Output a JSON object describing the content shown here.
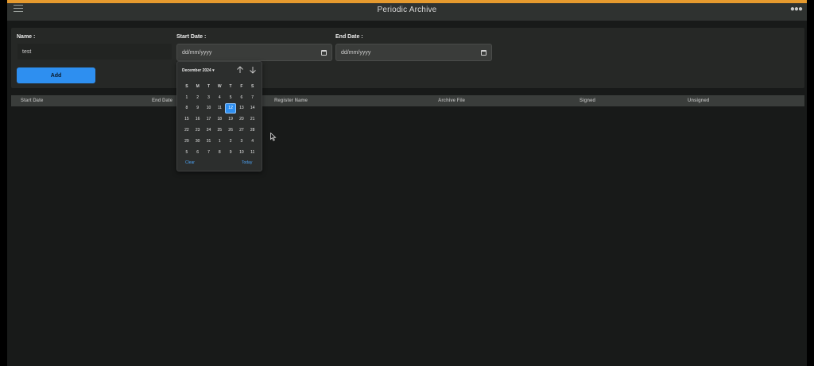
{
  "window": {
    "title": "Periodic Archive",
    "banner_text": "—"
  },
  "form": {
    "name_label": "Name :",
    "name_value": "test",
    "start_label": "Start Date :",
    "start_value": "dd/mm/yyyy",
    "end_label": "End Date :",
    "end_value": "dd/mm/yyyy",
    "add_label": "Add"
  },
  "table": {
    "columns": [
      "Start Date",
      "End Date",
      "Register Name",
      "Archive File",
      "Signed",
      "Unsigned"
    ]
  },
  "datepicker": {
    "month_label": "December 2024 ▾",
    "weekdays": [
      "S",
      "M",
      "T",
      "W",
      "T",
      "F",
      "S"
    ],
    "days": [
      "1",
      "2",
      "3",
      "4",
      "5",
      "6",
      "7",
      "8",
      "9",
      "10",
      "11",
      "12",
      "13",
      "14",
      "15",
      "16",
      "17",
      "18",
      "19",
      "20",
      "21",
      "22",
      "23",
      "24",
      "25",
      "26",
      "27",
      "28",
      "29",
      "30",
      "31",
      "1",
      "2",
      "3",
      "4",
      "5",
      "6",
      "7",
      "8",
      "9",
      "10",
      "11"
    ],
    "selected_day": "12",
    "clear_label": "Clear",
    "today_label": "Today"
  },
  "colors": {
    "accent": "#2e8ff0",
    "banner": "#e69a2e",
    "background": "#181a19"
  }
}
